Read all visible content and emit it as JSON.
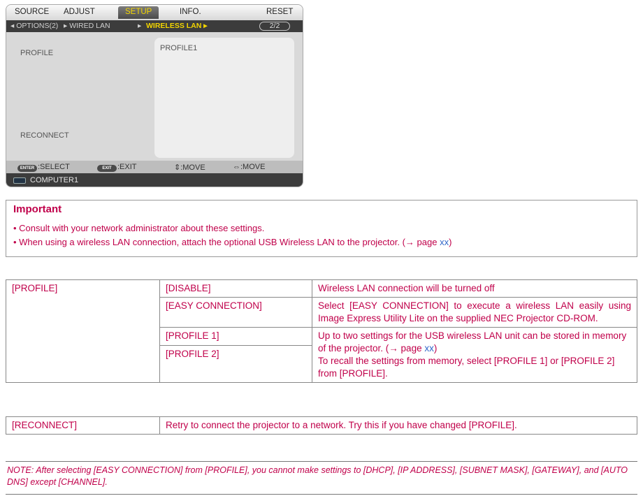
{
  "osd": {
    "tabs": [
      "SOURCE",
      "ADJUST",
      "SETUP",
      "INFO.",
      "RESET"
    ],
    "active_tab": "SETUP",
    "subtabs": [
      "◂ OPTIONS(2)",
      "▸ WIRED LAN",
      "▸",
      "WIRELESS LAN ▸"
    ],
    "page_indicator": "2/2",
    "labels": {
      "profile": "PROFILE",
      "reconnect": "RECONNECT"
    },
    "profile_value": "PROFILE1",
    "help": {
      "enter_key": "ENTER",
      "enter_text": ":SELECT",
      "exit_key": "EXIT",
      "exit_text": ":EXIT",
      "move_v": "⇕:MOVE",
      "move_h": "⇔:MOVE"
    },
    "source": "COMPUTER1"
  },
  "important": {
    "title": "Important",
    "bullets": [
      {
        "text": "• Consult with your network administrator about these settings."
      },
      {
        "text": "• When using a wireless LAN connection, attach the optional USB Wireless LAN to the projector. (→ page ",
        "link": "xx",
        "after": ")"
      }
    ]
  },
  "table": {
    "profile_label": "[PROFILE]",
    "rows": {
      "disable": {
        "option": "[DISABLE]",
        "desc": "Wireless LAN connection will be turned off"
      },
      "easy": {
        "option": "[EASY CONNECTION]",
        "desc": "Select [EASY CONNECTION] to execute a wireless LAN easily using Image Express Utility Lite on the supplied NEC Projector CD-ROM."
      },
      "profile1": {
        "option": "[PROFILE 1]"
      },
      "profile2": {
        "option": "[PROFILE 2]"
      },
      "profiles_desc_1": "Up to two settings for the USB wireless LAN unit can be stored in memory of the projector. (→ page ",
      "profiles_desc_link": "xx",
      "profiles_desc_2": ")",
      "profiles_desc_3": "To recall the settings from memory, select [PROFILE 1] or [PROFILE 2] from [PROFILE]."
    },
    "reconnect": {
      "label": "[RECONNECT]",
      "desc": "Retry to connect the projector to a network. Try this if you have changed [PROFILE]."
    }
  },
  "note": "NOTE: After selecting [EASY CONNECTION] from [PROFILE], you cannot make settings to [DHCP], [IP ADDRESS], [SUBNET MASK], [GATEWAY], and [AUTO DNS] except [CHANNEL].",
  "colors": {
    "text": "#c0004a",
    "link": "#2f66c9",
    "osd_highlight": "#f2d400"
  }
}
